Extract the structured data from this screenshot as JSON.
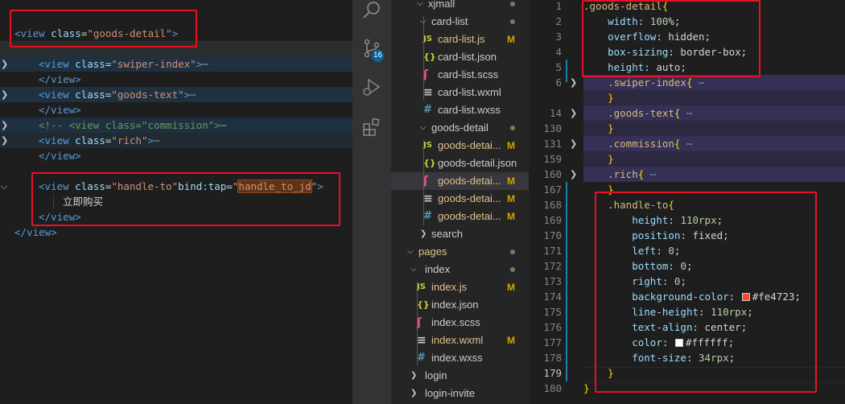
{
  "left_editor": {
    "lines": [
      {
        "tokens": [
          [
            "tag",
            "<view"
          ],
          [
            "txt",
            " "
          ],
          [
            "attr",
            "class"
          ],
          [
            "txt",
            "="
          ],
          [
            "str",
            "\"goods-detail\""
          ],
          [
            "tag",
            ">"
          ]
        ]
      },
      {
        "tokens": [
          [
            "tag",
            "<view"
          ],
          [
            "txt",
            " "
          ],
          [
            "attr",
            "class"
          ],
          [
            "txt",
            "="
          ],
          [
            "str",
            "\"swiper-index\""
          ],
          [
            "tag",
            ">"
          ],
          [
            "ell",
            "⋯"
          ]
        ]
      },
      {
        "tokens": [
          [
            "tag",
            "</view>"
          ]
        ]
      },
      {
        "tokens": [
          [
            "tag",
            "<view"
          ],
          [
            "txt",
            " "
          ],
          [
            "attr",
            "class"
          ],
          [
            "txt",
            "="
          ],
          [
            "str",
            "\"goods-text\""
          ],
          [
            "tag",
            ">"
          ],
          [
            "ell",
            "⋯"
          ]
        ]
      },
      {
        "tokens": [
          [
            "tag",
            "</view>"
          ]
        ]
      },
      {
        "tokens": [
          [
            "cmt",
            "<!-- <view class=\"commission\">"
          ],
          [
            "ell",
            "⋯"
          ]
        ]
      },
      {
        "tokens": [
          [
            "tag",
            "<view"
          ],
          [
            "txt",
            " "
          ],
          [
            "attr",
            "class"
          ],
          [
            "txt",
            "="
          ],
          [
            "str",
            "\"rich\""
          ],
          [
            "tag",
            ">"
          ],
          [
            "ell",
            "⋯"
          ]
        ]
      },
      {
        "tokens": [
          [
            "tag",
            "</view>"
          ]
        ]
      },
      {
        "tokens": [
          [
            "tag",
            "<view"
          ],
          [
            "txt",
            " "
          ],
          [
            "attr",
            "class"
          ],
          [
            "txt",
            "="
          ],
          [
            "str",
            "\"handle-to\""
          ],
          [
            "attr",
            "bind:tap"
          ],
          [
            "txt",
            "="
          ],
          [
            "str",
            "\""
          ],
          [
            "hl",
            "handle_to_jd"
          ],
          [
            "str",
            "\""
          ],
          [
            "tag",
            ">"
          ]
        ]
      },
      {
        "tokens": [
          [
            "cjk",
            "立即购买"
          ]
        ]
      },
      {
        "tokens": [
          [
            "tag",
            "</view>"
          ]
        ]
      },
      {
        "tokens": [
          [
            "tag",
            "</view>"
          ]
        ]
      }
    ]
  },
  "explorer": {
    "items": [
      {
        "name": "xjmall",
        "kind": "folder-open",
        "status": "dot"
      },
      {
        "name": "card-list",
        "kind": "folder-open",
        "status": "dot"
      },
      {
        "name": "card-list.js",
        "kind": "js",
        "status": "M"
      },
      {
        "name": "card-list.json",
        "kind": "json",
        "status": ""
      },
      {
        "name": "card-list.scss",
        "kind": "scss",
        "status": ""
      },
      {
        "name": "card-list.wxml",
        "kind": "wxml",
        "status": ""
      },
      {
        "name": "card-list.wxss",
        "kind": "wxss",
        "status": ""
      },
      {
        "name": "goods-detail",
        "kind": "folder-open",
        "status": "dot"
      },
      {
        "name": "goods-detai...",
        "kind": "js",
        "status": "M"
      },
      {
        "name": "goods-detail.json",
        "kind": "json",
        "status": ""
      },
      {
        "name": "goods-detai...",
        "kind": "scss",
        "status": "M"
      },
      {
        "name": "goods-detai...",
        "kind": "wxml",
        "status": "M"
      },
      {
        "name": "goods-detai...",
        "kind": "wxss",
        "status": "M"
      },
      {
        "name": "search",
        "kind": "folder-closed",
        "status": ""
      },
      {
        "name": "pages",
        "kind": "folder-open",
        "status": "dot"
      },
      {
        "name": "index",
        "kind": "folder-open",
        "status": "dot"
      },
      {
        "name": "index.js",
        "kind": "js",
        "status": "M"
      },
      {
        "name": "index.json",
        "kind": "json",
        "status": ""
      },
      {
        "name": "index.scss",
        "kind": "scss",
        "status": ""
      },
      {
        "name": "index.wxml",
        "kind": "wxml",
        "status": "M"
      },
      {
        "name": "index.wxss",
        "kind": "wxss",
        "status": ""
      },
      {
        "name": "login",
        "kind": "folder-closed",
        "status": ""
      },
      {
        "name": "login-invite",
        "kind": "folder-closed",
        "status": ""
      }
    ]
  },
  "activity_bar": {
    "icons": [
      "search-icon",
      "source-control-icon",
      "run-debug-icon",
      "extensions-icon"
    ],
    "scm_badge": "16"
  },
  "right_editor": {
    "lines": [
      {
        "n": "1",
        "tokens": [
          [
            "sel",
            ".goods-detail"
          ],
          [
            "brace",
            "{"
          ]
        ]
      },
      {
        "n": "2",
        "tokens": [
          [
            "val",
            "    "
          ],
          [
            "prop",
            "width"
          ],
          [
            "val",
            ": "
          ],
          [
            "num",
            "100"
          ],
          [
            "val",
            "%;"
          ]
        ]
      },
      {
        "n": "3",
        "tokens": [
          [
            "val",
            "    "
          ],
          [
            "prop",
            "overflow"
          ],
          [
            "val",
            ": hidden;"
          ]
        ]
      },
      {
        "n": "4",
        "tokens": [
          [
            "val",
            "    "
          ],
          [
            "prop",
            "box-sizing"
          ],
          [
            "val",
            ": border-box;"
          ]
        ]
      },
      {
        "n": "5",
        "tokens": [
          [
            "val",
            "    "
          ],
          [
            "prop",
            "height"
          ],
          [
            "val",
            ": auto;"
          ]
        ]
      },
      {
        "n": "6",
        "tokens": [
          [
            "val",
            "    "
          ],
          [
            "sel",
            ".swiper-index"
          ],
          [
            "brace",
            "{"
          ],
          [
            "ell",
            " ⋯"
          ]
        ]
      },
      {
        "n": "",
        "tokens": [
          [
            "val",
            "    "
          ],
          [
            "brace",
            "}"
          ]
        ]
      },
      {
        "n": "14",
        "tokens": [
          [
            "val",
            "    "
          ],
          [
            "sel",
            ".goods-text"
          ],
          [
            "brace",
            "{"
          ],
          [
            "ell",
            " ⋯"
          ]
        ]
      },
      {
        "n": "130",
        "tokens": [
          [
            "val",
            "    "
          ],
          [
            "brace",
            "}"
          ]
        ]
      },
      {
        "n": "131",
        "tokens": [
          [
            "val",
            "    "
          ],
          [
            "sel",
            ".commission"
          ],
          [
            "brace",
            "{"
          ],
          [
            "ell",
            " ⋯"
          ]
        ]
      },
      {
        "n": "159",
        "tokens": [
          [
            "val",
            "    "
          ],
          [
            "brace",
            "}"
          ]
        ]
      },
      {
        "n": "160",
        "tokens": [
          [
            "val",
            "    "
          ],
          [
            "sel",
            ".rich"
          ],
          [
            "brace",
            "{"
          ],
          [
            "ell",
            " ⋯"
          ]
        ]
      },
      {
        "n": "167",
        "tokens": [
          [
            "val",
            "    "
          ],
          [
            "brace",
            "}"
          ]
        ]
      },
      {
        "n": "168",
        "tokens": [
          [
            "val",
            "    "
          ],
          [
            "sel",
            ".handle-to"
          ],
          [
            "brace",
            "{"
          ]
        ]
      },
      {
        "n": "169",
        "tokens": [
          [
            "val",
            "        "
          ],
          [
            "prop",
            "height"
          ],
          [
            "val",
            ": "
          ],
          [
            "num",
            "110"
          ],
          [
            "unit",
            "rpx"
          ],
          [
            "val",
            ";"
          ]
        ]
      },
      {
        "n": "170",
        "tokens": [
          [
            "val",
            "        "
          ],
          [
            "prop",
            "position"
          ],
          [
            "val",
            ": fixed;"
          ]
        ]
      },
      {
        "n": "171",
        "tokens": [
          [
            "val",
            "        "
          ],
          [
            "prop",
            "left"
          ],
          [
            "val",
            ": "
          ],
          [
            "num",
            "0"
          ],
          [
            "val",
            ";"
          ]
        ]
      },
      {
        "n": "172",
        "tokens": [
          [
            "val",
            "        "
          ],
          [
            "prop",
            "bottom"
          ],
          [
            "val",
            ": "
          ],
          [
            "num",
            "0"
          ],
          [
            "val",
            ";"
          ]
        ]
      },
      {
        "n": "173",
        "tokens": [
          [
            "val",
            "        "
          ],
          [
            "prop",
            "right"
          ],
          [
            "val",
            ": "
          ],
          [
            "num",
            "0"
          ],
          [
            "val",
            ";"
          ]
        ]
      },
      {
        "n": "174",
        "tokens": [
          [
            "val",
            "        "
          ],
          [
            "prop",
            "background-color"
          ],
          [
            "val",
            ": "
          ],
          [
            "swatch",
            "#fe4723"
          ],
          [
            "val",
            "#fe4723;"
          ]
        ]
      },
      {
        "n": "175",
        "tokens": [
          [
            "val",
            "        "
          ],
          [
            "prop",
            "line-height"
          ],
          [
            "val",
            ": "
          ],
          [
            "num",
            "110"
          ],
          [
            "unit",
            "rpx"
          ],
          [
            "val",
            ";"
          ]
        ]
      },
      {
        "n": "176",
        "tokens": [
          [
            "val",
            "        "
          ],
          [
            "prop",
            "text-align"
          ],
          [
            "val",
            ": center;"
          ]
        ]
      },
      {
        "n": "177",
        "tokens": [
          [
            "val",
            "        "
          ],
          [
            "prop",
            "color"
          ],
          [
            "val",
            ": "
          ],
          [
            "swatch",
            "#ffffff"
          ],
          [
            "val",
            "#ffffff;"
          ]
        ]
      },
      {
        "n": "178",
        "tokens": [
          [
            "val",
            "        "
          ],
          [
            "prop",
            "font-size"
          ],
          [
            "val",
            ": "
          ],
          [
            "num",
            "34"
          ],
          [
            "unit",
            "rpx"
          ],
          [
            "val",
            ";"
          ]
        ]
      },
      {
        "n": "179",
        "tokens": [
          [
            "val",
            "    "
          ],
          [
            "brace",
            "}"
          ]
        ]
      },
      {
        "n": "180",
        "tokens": [
          [
            "brace",
            "}"
          ]
        ]
      }
    ]
  },
  "colors": {
    "annotation_red": "#e81123",
    "handle_bg_swatch": "#fe4723",
    "handle_color_swatch": "#ffffff"
  }
}
